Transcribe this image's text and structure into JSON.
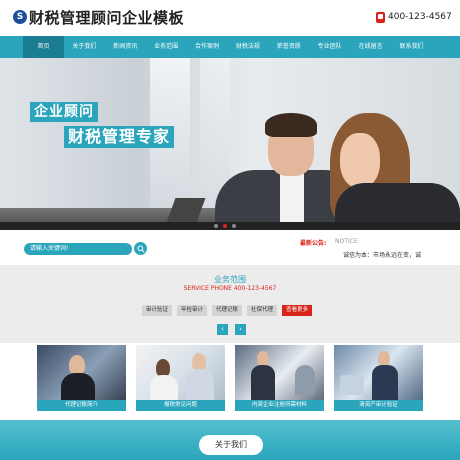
{
  "header": {
    "logo_mark": "S",
    "site_title": "财税管理顾问企业模板",
    "phone": "400-123-4567",
    "phone_icon": "phone-icon"
  },
  "nav": {
    "items": [
      {
        "label": "首页"
      },
      {
        "label": "关于我们"
      },
      {
        "label": "新闻资讯"
      },
      {
        "label": "业务范围"
      },
      {
        "label": "合作案例"
      },
      {
        "label": "财税法规"
      },
      {
        "label": "荣誉资质"
      },
      {
        "label": "专业团队"
      },
      {
        "label": "在线留言"
      },
      {
        "label": "联系我们"
      }
    ],
    "active_index": 0
  },
  "banner": {
    "slogan_line1": "企业顾问",
    "slogan_line2": "财税管理专家",
    "slide_count": 3,
    "active_slide": 1
  },
  "search": {
    "placeholder": "请输入关键词!",
    "button_icon": "search-icon"
  },
  "notice": {
    "label": "最新公告:",
    "label_en": "NOTICE",
    "text": "诚信为本：市场永远在变，诚"
  },
  "business": {
    "title": "业务范围",
    "phone_line": "SERVICE PHONE 400-123-4567",
    "tags": [
      "审计验证",
      "年检审计",
      "代理记账",
      "社保代理",
      "查看更多"
    ],
    "prev_icon": "chevron-left-icon",
    "next_icon": "chevron-right-icon"
  },
  "cards": [
    {
      "caption": "代理记账简介"
    },
    {
      "caption": "报税常见问题"
    },
    {
      "caption": "内资企业注册所需材料"
    },
    {
      "caption": "清资产审计验证"
    }
  ],
  "about": {
    "button_label": "关于我们"
  },
  "colors": {
    "accent": "#2aa5bc",
    "accent_dark": "#1b7d91",
    "red": "#d9241c"
  }
}
